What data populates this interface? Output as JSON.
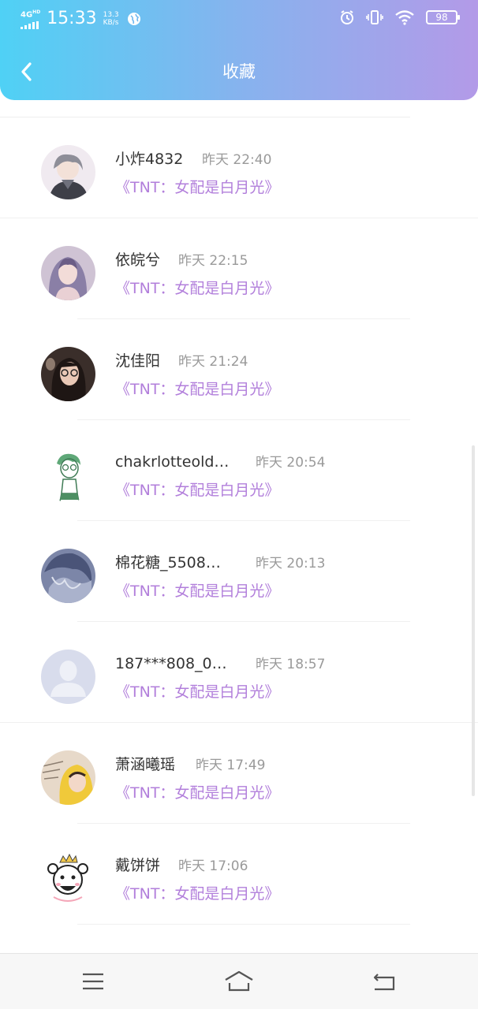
{
  "status_bar": {
    "network": "4G",
    "network_sup": "HD",
    "time": "15:33",
    "speed_value": "13.3",
    "speed_unit": "KB/s",
    "battery": "98"
  },
  "header": {
    "title": "收藏",
    "back_icon": "chevron-left-icon"
  },
  "favorites": [
    {
      "name": "小炸4832",
      "time": "昨天 22:40",
      "book": "《TNT：女配是白月光》",
      "avatar": "anime-boy-avatar"
    },
    {
      "name": "依皖兮",
      "time": "昨天 22:15",
      "book": "《TNT：女配是白月光》",
      "avatar": "girl-photo-avatar"
    },
    {
      "name": "沈佳阳",
      "time": "昨天 21:24",
      "book": "《TNT：女配是白月光》",
      "avatar": "glasses-photo-avatar"
    },
    {
      "name": "chakrlotteold…",
      "time": "昨天 20:54",
      "book": "《TNT：女配是白月光》",
      "avatar": "sketch-girl-avatar"
    },
    {
      "name": "棉花糖_5508…",
      "time": "昨天 20:13",
      "book": "《TNT：女配是白月光》",
      "avatar": "blue-hair-avatar"
    },
    {
      "name": "187***808_0…",
      "time": "昨天 18:57",
      "book": "《TNT：女配是白月光》",
      "avatar": "default-user-avatar"
    },
    {
      "name": "萧涵曦瑶",
      "time": "昨天 17:49",
      "book": "《TNT：女配是白月光》",
      "avatar": "yellow-hood-avatar"
    },
    {
      "name": "戴饼饼",
      "time": "昨天 17:06",
      "book": "《TNT：女配是白月光》",
      "avatar": "cartoon-face-avatar"
    }
  ],
  "nav_bar": {
    "menu_icon": "menu-icon",
    "home_icon": "home-icon",
    "back_icon": "back-icon"
  },
  "colors": {
    "header_gradient_start": "#4fd1f5",
    "header_gradient_end": "#b39ae8",
    "book_title": "#b27fdb",
    "time_text": "#9a9a9a",
    "name_text": "#333333"
  }
}
